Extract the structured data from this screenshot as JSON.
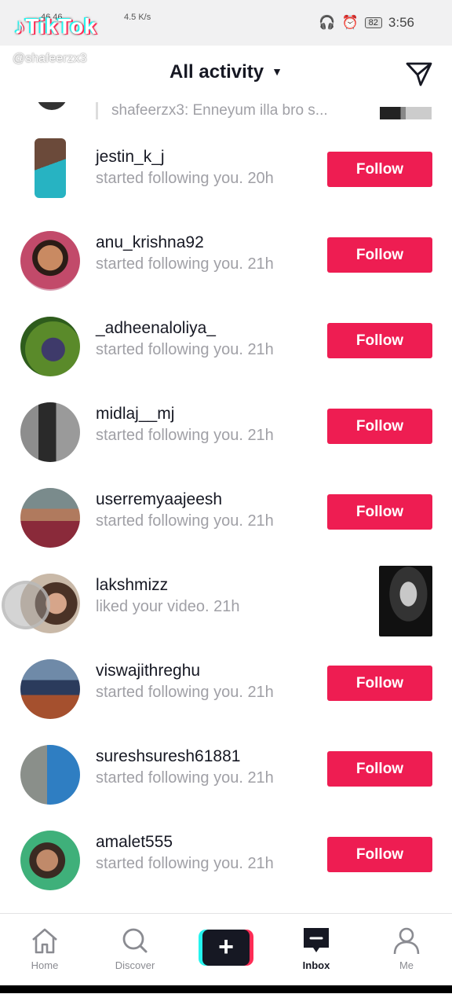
{
  "status_bar": {
    "left": "46 46",
    "speed": "4.5 K/s",
    "battery": "82",
    "time": "3:56"
  },
  "watermark": {
    "brand": "TikTok",
    "handle": "@shafeerzx3"
  },
  "header": {
    "title": "All activity"
  },
  "partial_row": {
    "text": "shafeerzx3: Enneyum illa bro s..."
  },
  "activity": [
    {
      "username": "jestin_k_j",
      "text": "started following you. 20h",
      "action": "Follow"
    },
    {
      "username": "anu_krishna92",
      "text": "started following you. 21h",
      "action": "Follow"
    },
    {
      "username": "_adheenaloliya_",
      "text": "started following you. 21h",
      "action": "Follow"
    },
    {
      "username": "midlaj__mj",
      "text": "started following you. 21h",
      "action": "Follow"
    },
    {
      "username": "userremyaajeesh",
      "text": "started following you. 21h",
      "action": "Follow"
    },
    {
      "username": "lakshmizz",
      "text": "liked your video. 21h",
      "action": ""
    },
    {
      "username": "viswajithreghu",
      "text": "started following you. 21h",
      "action": "Follow"
    },
    {
      "username": "sureshsuresh61881",
      "text": "started following you. 21h",
      "action": "Follow"
    },
    {
      "username": "amalet555",
      "text": "started following you. 21h",
      "action": "Follow"
    }
  ],
  "nav": {
    "home": "Home",
    "discover": "Discover",
    "create": "+",
    "inbox": "Inbox",
    "me": "Me"
  },
  "colors": {
    "follow": "#ee1d52",
    "cyan": "#25f4ee",
    "pink": "#fe2c55"
  }
}
